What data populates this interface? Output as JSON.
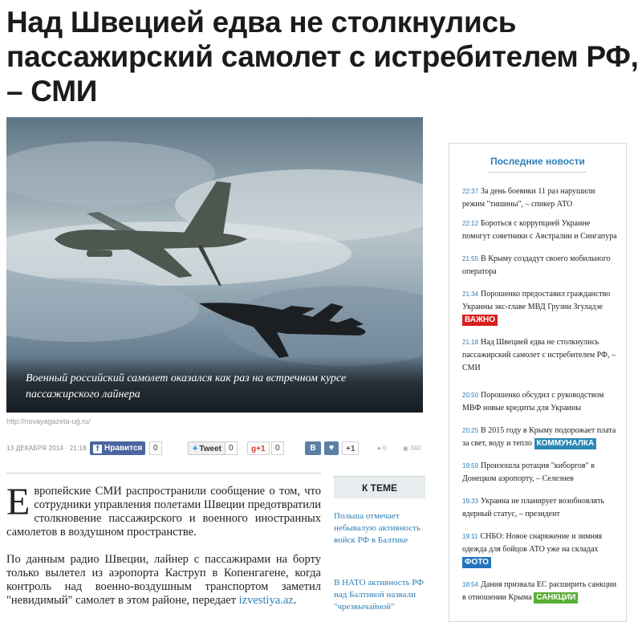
{
  "headline": "Над Швецией едва не столкнулись пассажирский самолет с истребителем РФ, – СМИ",
  "hero": {
    "caption": "Военный российский самолет оказался как раз на встречном курсе пассажирского лайнера"
  },
  "source": "http://novayagazeta-ug.ru/",
  "social": {
    "date": "13 ДЕКАБРЯ 2014 · 21:18",
    "facebook_label": "Нравится",
    "facebook_count": "0",
    "twitter_label": "Tweet",
    "twitter_count": "0",
    "gplus_label": "g+1",
    "gplus_count": "0",
    "vk_label": "В",
    "plus_one_label": "+1",
    "comments": "0",
    "views": "340"
  },
  "article": {
    "dropcap": "Е",
    "p1": "вропейские СМИ распространили сообщение о том, что сотрудники управления полетами Швеции предотвратили столкновение пассажирского и военного иностранных самолетов в воздушном пространстве.",
    "p2": "По данным радио Швеции, лайнер с пассажирами на борту только вылетел из аэропорта Каструп в Копенгагене, когда контроль над военно-воздушным транспортом заметил \"невидимый\" самолет в этом районе, передает ",
    "p2_link": "izvestiya.az",
    "p2_end": "."
  },
  "related": {
    "header": "К ТЕМЕ",
    "items": [
      "Польша отмечает небывалую активность войск РФ в Балтике",
      "В НАТО активность РФ над Балтикой назвали \"чрезвычайной\""
    ]
  },
  "news": {
    "title": "Последние новости",
    "items": [
      {
        "time": "22:37",
        "text": "За день боевики 11 раз нарушили режим \"тишины\", – спикер АТО",
        "tag": ""
      },
      {
        "time": "22:12",
        "text": "Бороться с коррупцией Украине помогут советники с Австралии и Сингапура",
        "tag": ""
      },
      {
        "time": "21:55",
        "text": "В Крыму создадут своего мобильного оператора",
        "tag": ""
      },
      {
        "time": "21:34",
        "text": "Порошенко предоставил гражданство Украины экс-главе МВД Грузии Згуладзе",
        "tag": "ВАЖНО"
      },
      {
        "time": "21:18",
        "text": "Над Швецией едва не столкнулись пассажирский самолет с истребителем РФ, – СМИ",
        "tag": ""
      },
      {
        "time": "20:50",
        "text": "Порошенко обсудил с руководством МВФ новые кредиты для Украины",
        "tag": ""
      },
      {
        "time": "20:25",
        "text": "В 2015 году в Крыму подорожает плата за свет, воду и тепло",
        "tag": "КОММУНАЛКА"
      },
      {
        "time": "19:59",
        "text": "Произошла ротация \"киборгов\" в Донецком аэропорту, – Селезнев",
        "tag": ""
      },
      {
        "time": "19:33",
        "text": "Украина не планирует возобновлять ядерный статус, – президент",
        "tag": ""
      },
      {
        "time": "19:11",
        "text": "СНБО: Новое снаряжение и зимняя одежда для бойцов АТО уже на складах",
        "tag": "ФОТО"
      },
      {
        "time": "18:54",
        "text": "Дания призвала ЕС расширить санкции в отношении Крыма",
        "tag": "САНКЦИИ"
      }
    ]
  },
  "colors": {
    "link": "#2d7fb8",
    "tag_vazhno": "#d81e1e",
    "tag_kommunalka": "#2a88b4",
    "tag_foto": "#2473bf",
    "tag_sanktsii": "#5aaf36"
  }
}
